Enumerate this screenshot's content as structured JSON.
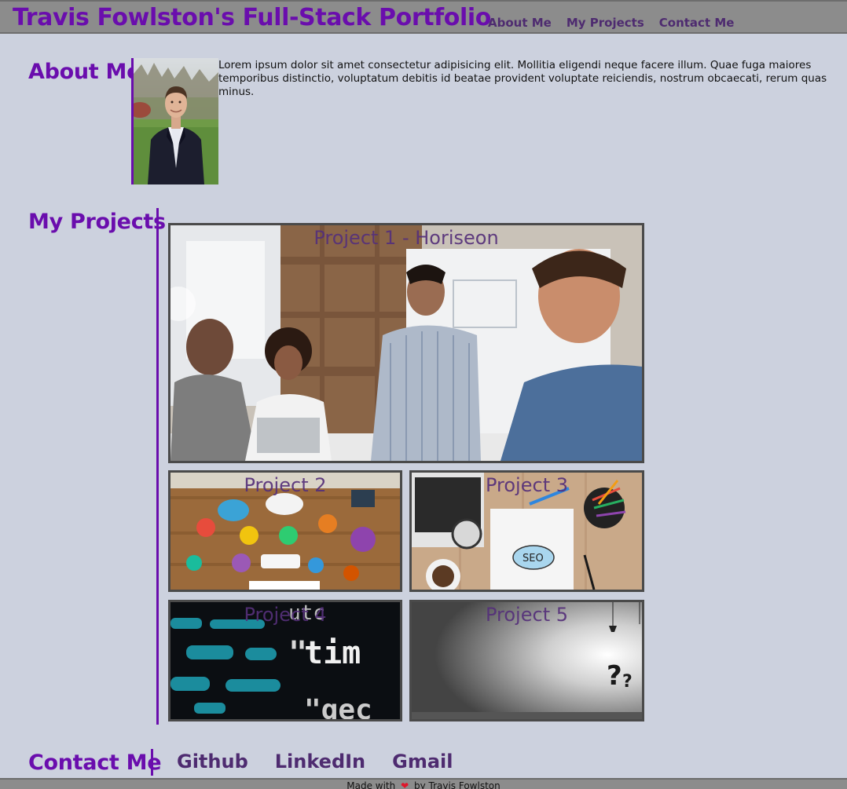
{
  "header": {
    "title": "Travis Fowlston's Full-Stack Portfolio",
    "nav": [
      "About Me",
      "My Projects",
      "Contact Me"
    ]
  },
  "about": {
    "heading": "About Me",
    "text": "Lorem ipsum dolor sit amet consectetur adipisicing elit. Mollitia eligendi neque facere illum. Quae fuga maiores temporibus distinctio, voluptatum debitis id beatae provident voluptate reiciendis, nostrum obcaecati, rerum quas minus."
  },
  "projects": {
    "heading": "My Projects",
    "items": [
      {
        "title": "Project 1 - Horiseon"
      },
      {
        "title": "Project 2"
      },
      {
        "title": "Project 3"
      },
      {
        "title": "Project 4"
      },
      {
        "title": "Project 5"
      }
    ]
  },
  "contact": {
    "heading": "Contact Me",
    "links": [
      "Github",
      "LinkedIn",
      "Gmail"
    ]
  },
  "footer": {
    "before": "Made with",
    "icon": "heart-icon",
    "after": "by Travis Fowlston"
  },
  "colors": {
    "background": "#ccd1de",
    "bar": "#8c8c8c",
    "accent": "#6a0dad",
    "link": "#4e2b70"
  }
}
